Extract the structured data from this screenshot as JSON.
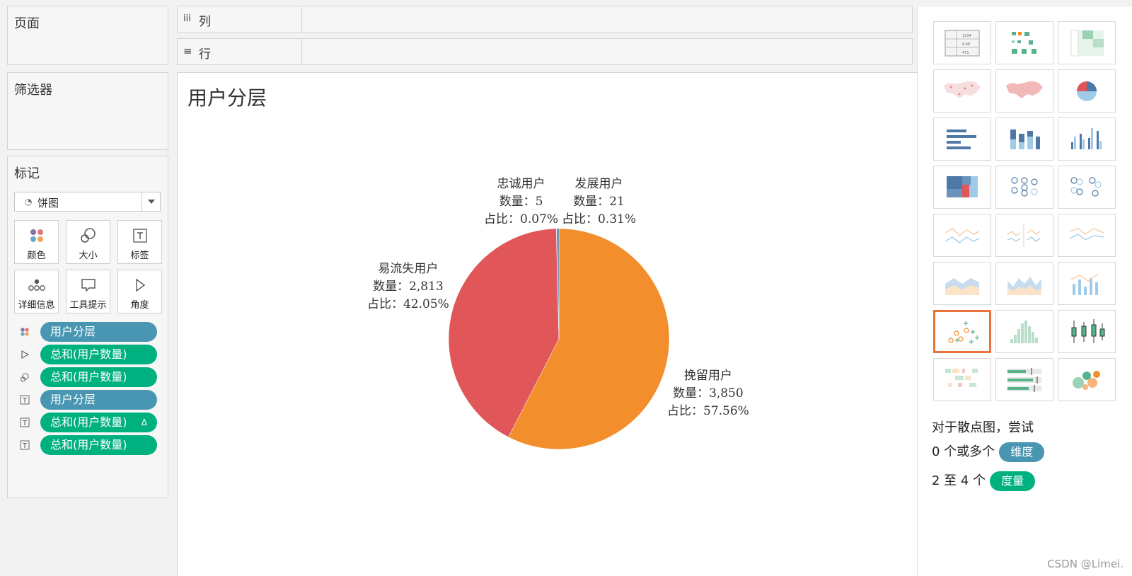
{
  "left_panel": {
    "pages_title": "页面",
    "filters_title": "筛选器",
    "marks_title": "标记",
    "mark_type": {
      "value": "饼图",
      "icon": "pie-mark-icon"
    },
    "mark_buttons": [
      {
        "label": "颜色",
        "icon": "color-dots-icon"
      },
      {
        "label": "大小",
        "icon": "size-circles-icon"
      },
      {
        "label": "标签",
        "icon": "text-t-icon"
      },
      {
        "label": "详细信息",
        "icon": "detail-dots-icon"
      },
      {
        "label": "工具提示",
        "icon": "tooltip-bubble-icon"
      },
      {
        "label": "角度",
        "icon": "angle-icon"
      }
    ],
    "mark_fields": [
      {
        "icon": "color-dots-icon",
        "label": "用户分层",
        "kind": "dimension"
      },
      {
        "icon": "angle-icon",
        "label": "总和(用户数量)",
        "kind": "measure"
      },
      {
        "icon": "size-circles-icon",
        "label": "总和(用户数量)",
        "kind": "measure"
      },
      {
        "icon": "text-t-icon",
        "label": "用户分层",
        "kind": "dimension"
      },
      {
        "icon": "text-t-icon",
        "label": "总和(用户数量)",
        "kind": "measure",
        "badge": "Δ"
      },
      {
        "icon": "text-t-icon",
        "label": "总和(用户数量)",
        "kind": "measure"
      }
    ]
  },
  "shelves": {
    "columns": {
      "icon": "iii",
      "label": "列"
    },
    "rows": {
      "icon": "≡",
      "label": "行"
    }
  },
  "sheet": {
    "title": "用户分层"
  },
  "chart_data": {
    "type": "pie",
    "title": "用户分层",
    "slices": [
      {
        "name": "挽留用户",
        "count_label": "数量：3,850",
        "share_label": "占比：57.56%",
        "value": 3850,
        "color": "#f28e2b"
      },
      {
        "name": "易流失用户",
        "count_label": "数量：2,813",
        "share_label": "占比：42.05%",
        "value": 2813,
        "color": "#e15759"
      },
      {
        "name": "忠诚用户",
        "count_label": "数量：5",
        "share_label": "占比：0.07%",
        "value": 5,
        "color": "#76b7b2"
      },
      {
        "name": "发展用户",
        "count_label": "数量：21",
        "share_label": "占比：0.31%",
        "value": 21,
        "color": "#4e79a7"
      }
    ]
  },
  "show_me": {
    "thumbnails": [
      "text-table",
      "heat-map",
      "highlight-table",
      "symbol-map",
      "filled-map",
      "pie-chart",
      "horizontal-bars",
      "stacked-bars",
      "side-by-side-bars",
      "treemap",
      "circle-views",
      "side-by-side-circles",
      "lines-continuous",
      "lines-discrete",
      "dual-lines",
      "area-continuous",
      "area-discrete",
      "dual-combination",
      "scatter-plot",
      "histogram",
      "box-and-whisker",
      "gantt-chart",
      "bullet-graph",
      "packed-bubbles"
    ],
    "selected": "scatter-plot",
    "hint_title": "对于散点图，尝试",
    "hint_line1_text": "0 个或多个",
    "hint_line1_pill": "维度",
    "hint_line2_text": "2 至 4 个",
    "hint_line2_pill": "度量"
  },
  "watermark": "CSDN @Limei."
}
